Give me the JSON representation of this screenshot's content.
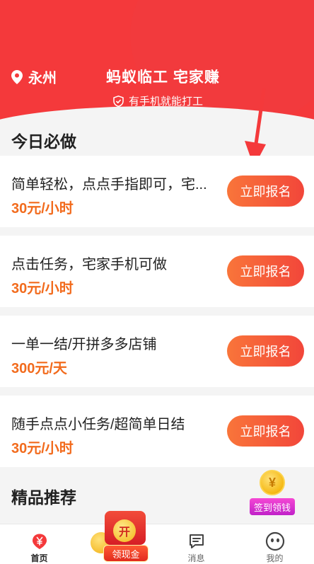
{
  "header": {
    "location": "永州",
    "slogan": "蚂蚁临工 宅家赚",
    "subtitle": "有手机就能打工"
  },
  "sections": {
    "today": "今日必做",
    "recommend": "精品推荐"
  },
  "tasks": [
    {
      "title": "简单轻松，点点手指即可，宅...",
      "price": "30元/小时",
      "button": "立即报名"
    },
    {
      "title": "点击任务，宅家手机可做",
      "price": "30元/小时",
      "button": "立即报名"
    },
    {
      "title": "一单一结/开拼多多店铺",
      "price": "300元/天",
      "button": "立即报名"
    },
    {
      "title": "随手点点小任务/超简单日结",
      "price": "30元/小时",
      "button": "立即报名"
    }
  ],
  "signin": {
    "coin_glyph": "¥",
    "label": "签到领钱"
  },
  "tabbar": {
    "home": "首页",
    "redpacket_open": "开",
    "redpacket_label": "领现金",
    "messages": "消息",
    "mine": "我的"
  },
  "colors": {
    "brand_red": "#f4393b",
    "price_orange": "#f26b1d",
    "button_gradient_start": "#f9753a",
    "button_gradient_end": "#f2463a"
  },
  "icons": [
    "location-pin-icon",
    "shield-check-icon",
    "arrow-pointer-icon",
    "home-yuan-icon",
    "message-icon",
    "profile-face-icon",
    "coin-icon",
    "red-packet-icon"
  ]
}
